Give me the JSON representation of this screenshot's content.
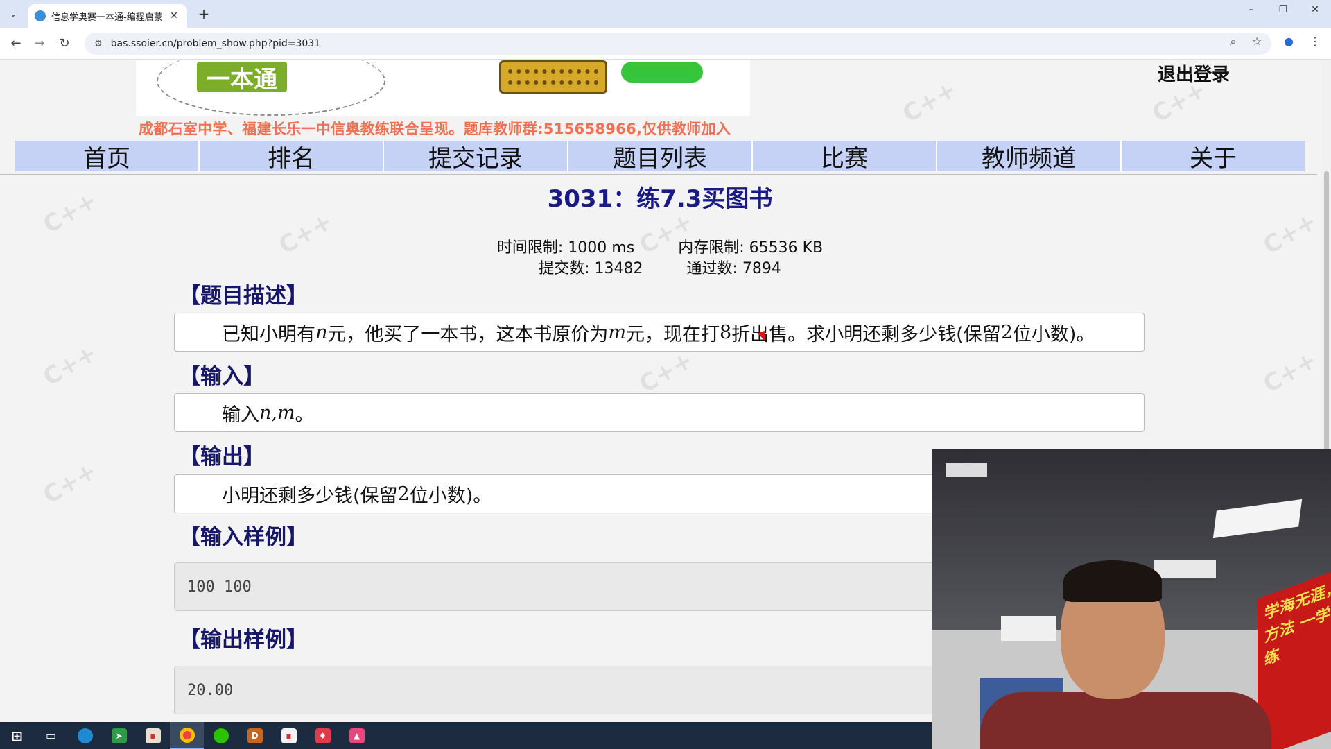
{
  "browser": {
    "tab_title": "信息学奥赛一本通-编程启蒙（C",
    "tab_close": "✕",
    "new_tab": "+",
    "url": "bas.ssoier.cn/problem_show.php?pid=3031",
    "window_controls": {
      "minimize": "–",
      "restore": "❐",
      "close": "✕"
    }
  },
  "header": {
    "logo_text": "一本通",
    "logout": "退出登录",
    "notice": "成都石室中学、福建长乐一中信奥教练联合呈现。题库教师群:515658966,仅供教师加入"
  },
  "nav": {
    "items": [
      "首页",
      "排名",
      "提交记录",
      "题目列表",
      "比赛",
      "教师频道",
      "关于"
    ]
  },
  "problem": {
    "title": "3031：练7.3买图书",
    "time_limit": "时间限制: 1000 ms",
    "memory_limit": "内存限制: 65536 KB",
    "submissions": "提交数: 13482",
    "accepted": "通过数: 7894",
    "sections": {
      "description_h": "【题目描述】",
      "description_parts": [
        "已知小明有",
        "n",
        "元，他买了一本书，这本书原价为",
        "m",
        "元，现在打",
        "8",
        "折出售。求小明还剩多少钱(保留",
        "2",
        "位小数)。"
      ],
      "input_h": "【输入】",
      "input_parts": [
        "输入",
        "n,m",
        "。"
      ],
      "output_h": "【输出】",
      "output_parts": [
        "小明还剩多少钱(保留",
        "2",
        "位小数)。"
      ],
      "sample_in_h": "【输入样例】",
      "sample_in": "100 100",
      "sample_out_h": "【输出样例】",
      "sample_out": "20.00"
    }
  },
  "webcam": {
    "banner_text": "学海无涯，方法 一学二练"
  },
  "watermark": "C++"
}
